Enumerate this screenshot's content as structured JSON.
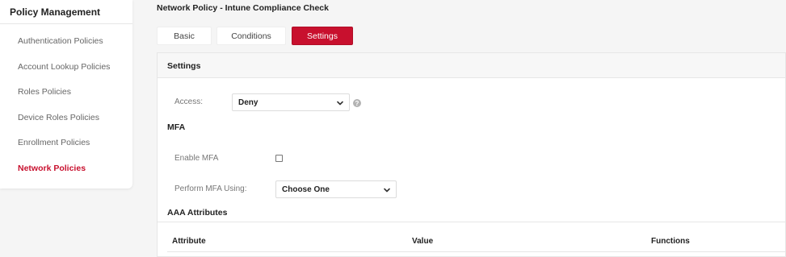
{
  "sidebar": {
    "title": "Policy Management",
    "items": [
      {
        "label": "Authentication Policies"
      },
      {
        "label": "Account Lookup Policies"
      },
      {
        "label": "Roles Policies"
      },
      {
        "label": "Device Roles Policies"
      },
      {
        "label": "Enrollment Policies"
      },
      {
        "label": "Network Policies"
      }
    ]
  },
  "page": {
    "title": "Network Policy - Intune Compliance Check"
  },
  "tabs": [
    {
      "label": "Basic"
    },
    {
      "label": "Conditions"
    },
    {
      "label": "Settings"
    }
  ],
  "settings": {
    "header": "Settings",
    "access_label": "Access:",
    "access_value": "Deny",
    "help_glyph": "?",
    "mfa_section": "MFA",
    "enable_mfa_label": "Enable MFA",
    "perform_mfa_label": "Perform MFA Using:",
    "perform_mfa_value": "Choose One",
    "aaa_section": "AAA Attributes",
    "table_headers": [
      "Attribute",
      "Value",
      "Functions"
    ]
  },
  "colors": {
    "accent": "#c8102e",
    "background": "#f5f5f5"
  }
}
